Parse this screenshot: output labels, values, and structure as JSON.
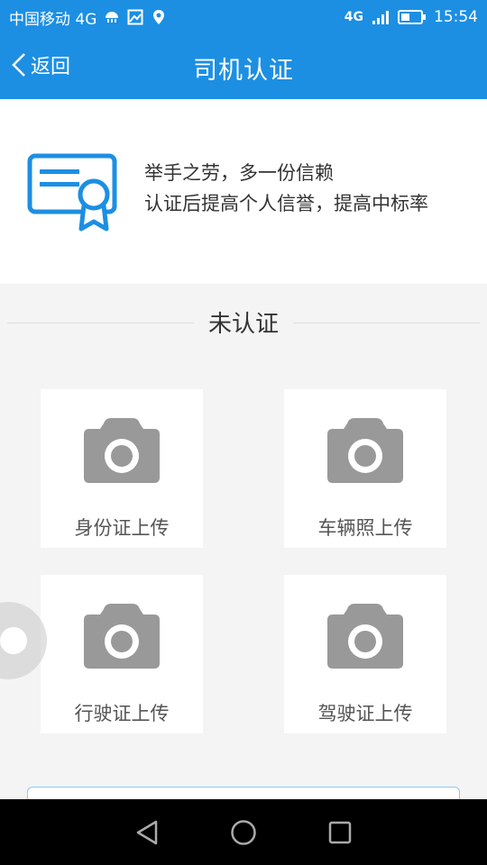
{
  "status_bar": {
    "carrier": "中国移动 4G",
    "network": "4G",
    "time": "15:54"
  },
  "header": {
    "back_label": "返回",
    "title": "司机认证"
  },
  "intro": {
    "line1": "举手之劳，多一份信赖",
    "line2": "认证后提高个人信誉，提高中标率"
  },
  "verification_status": "未认证",
  "uploads": [
    {
      "label": "身份证上传",
      "icon": "camera-icon"
    },
    {
      "label": "车辆照上传",
      "icon": "camera-icon"
    },
    {
      "label": "行驶证上传",
      "icon": "camera-icon"
    },
    {
      "label": "驾驶证上传",
      "icon": "camera-icon"
    }
  ],
  "colors": {
    "primary": "#1c8fe3",
    "background": "#f4f4f4",
    "camera": "#999999"
  }
}
